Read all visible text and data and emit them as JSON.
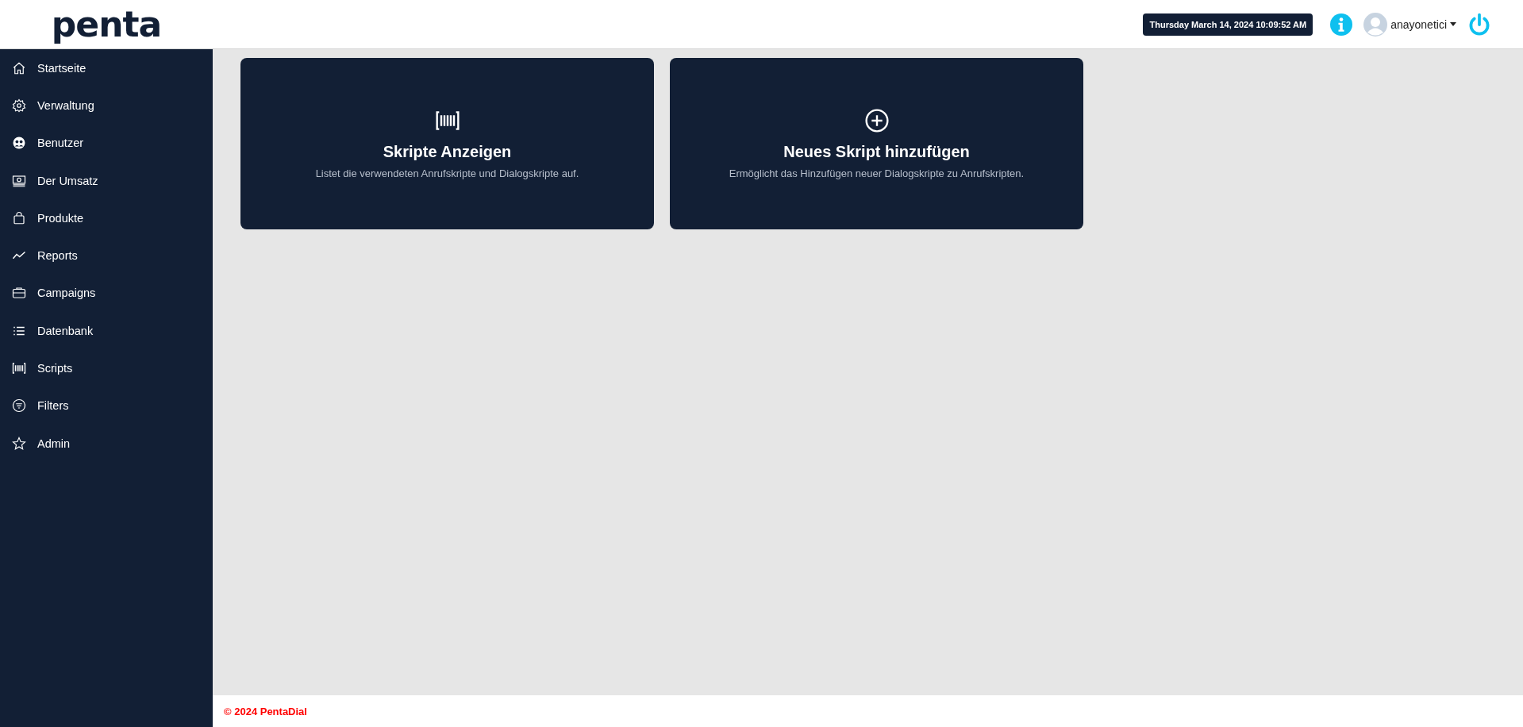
{
  "header": {
    "logo": "penta",
    "datetime": "Thursday March 14, 2024 10:09:52 AM",
    "user": "anayonetici"
  },
  "sidebar": {
    "items": [
      {
        "label": "Startseite"
      },
      {
        "label": "Verwaltung"
      },
      {
        "label": "Benutzer"
      },
      {
        "label": "Der Umsatz"
      },
      {
        "label": "Produkte"
      },
      {
        "label": "Reports"
      },
      {
        "label": "Campaigns"
      },
      {
        "label": "Datenbank"
      },
      {
        "label": "Scripts"
      },
      {
        "label": "Filters"
      },
      {
        "label": "Admin"
      }
    ]
  },
  "cards": [
    {
      "title": "Skripte Anzeigen",
      "description": "Listet die verwendeten Anrufskripte und Dialogskripte auf."
    },
    {
      "title": "Neues Skript hinzufügen",
      "description": "Ermöglicht das Hinzufügen neuer Dialogskripte zu Anrufskripten."
    }
  ],
  "footer": "© 2024 PentaDial"
}
